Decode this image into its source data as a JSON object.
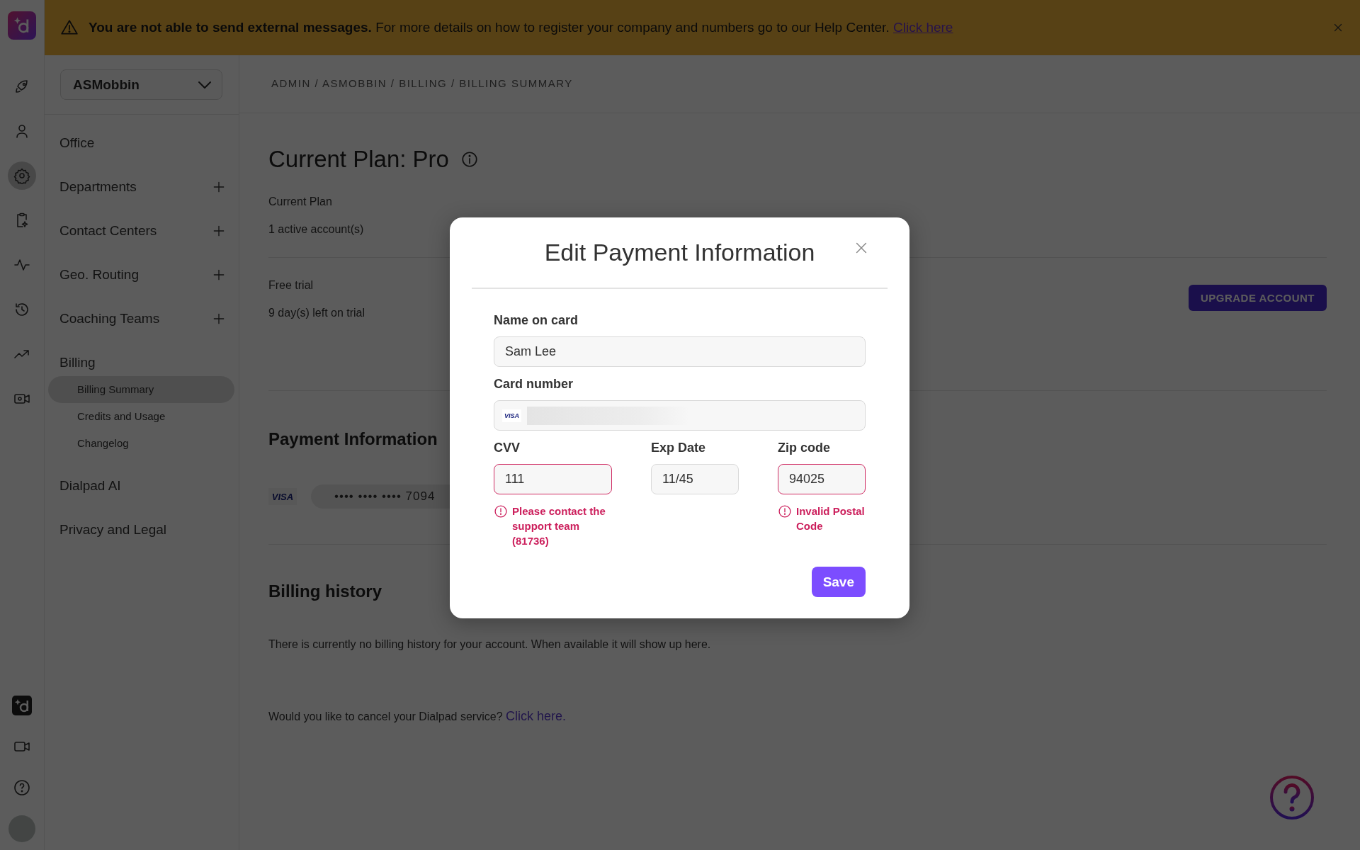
{
  "banner": {
    "bold": "You are not able to send external messages.",
    "text": "For more details on how to register your company and numbers go to our Help Center.",
    "link": "Click here"
  },
  "rail": {
    "top": [
      {
        "kind": "rocket",
        "selected": false
      },
      {
        "kind": "person",
        "selected": false
      },
      {
        "kind": "gear",
        "selected": true
      },
      {
        "kind": "clipboard",
        "selected": false
      },
      {
        "kind": "pulse",
        "selected": false
      },
      {
        "kind": "history",
        "selected": false
      },
      {
        "kind": "trend",
        "selected": false
      },
      {
        "kind": "camera",
        "selected": false
      }
    ],
    "bottom": [
      {
        "kind": "logo"
      },
      {
        "kind": "video"
      },
      {
        "kind": "help"
      },
      {
        "kind": "avatar"
      }
    ]
  },
  "sidebar": {
    "account": "ASMobbin",
    "items": [
      {
        "label": "Office",
        "expandable": false
      },
      {
        "label": "Departments",
        "expandable": true
      },
      {
        "label": "Contact Centers",
        "expandable": true
      },
      {
        "label": "Geo. Routing",
        "expandable": true
      },
      {
        "label": "Coaching Teams",
        "expandable": true
      },
      {
        "label": "Billing",
        "expandable": false,
        "children": [
          {
            "label": "Billing Summary",
            "selected": true
          },
          {
            "label": "Credits and Usage",
            "selected": false
          },
          {
            "label": "Changelog",
            "selected": false
          }
        ]
      },
      {
        "label": "Dialpad AI",
        "expandable": false
      },
      {
        "label": "Privacy and Legal",
        "expandable": false
      }
    ]
  },
  "breadcrumb": "ADMIN / ASMOBBIN / BILLING / BILLING SUMMARY",
  "main": {
    "title": "Current Plan: Pro",
    "plan_label": "Current Plan",
    "plan_value": "1 active account(s)",
    "trial_label": "Free trial",
    "trial_value": "9 day(s) left on trial",
    "upgrade_button": "UPGRADE ACCOUNT",
    "payment_title": "Payment Information",
    "card_brand": "VISA",
    "card_masked": "•••• •••• •••• 7094",
    "history_title": "Billing history",
    "history_text": "There is currently no billing history for your account. When available it will show up here.",
    "cancel_text": "Would you like to cancel your Dialpad service?",
    "cancel_link": "Click here."
  },
  "modal": {
    "title": "Edit Payment Information",
    "name_label": "Name on card",
    "name_value": "Sam Lee",
    "card_label": "Card number",
    "card_brand": "VISA",
    "fields": [
      {
        "label": "CVV",
        "value": "111",
        "invalid": true,
        "error": "Please contact the support team (81736)"
      },
      {
        "label": "Exp Date",
        "value": "11/45",
        "invalid": false
      },
      {
        "label": "Zip code",
        "value": "94025",
        "invalid": true,
        "error": "Invalid Postal Code"
      }
    ],
    "save_button": "Save"
  }
}
